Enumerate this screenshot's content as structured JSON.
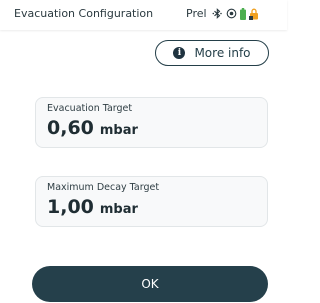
{
  "header": {
    "title": "Evacuation Configuration",
    "mode_label": "Prel"
  },
  "status_icons": [
    "bluetooth-icon",
    "target-icon",
    "battery-icon",
    "lock-icon"
  ],
  "colors": {
    "primary_dark": "#25404b",
    "battery_green": "#4caf50",
    "lock_orange": "#f0a020",
    "card_background": "#f8f9fa"
  },
  "more_info": {
    "label": "More info",
    "icon_glyph": "i"
  },
  "fields": [
    {
      "label": "Evacuation Target",
      "value": "0,60",
      "unit": "mbar"
    },
    {
      "label": "Maximum Decay Target",
      "value": "1,00",
      "unit": "mbar"
    }
  ],
  "ok_button": {
    "label": "OK"
  }
}
